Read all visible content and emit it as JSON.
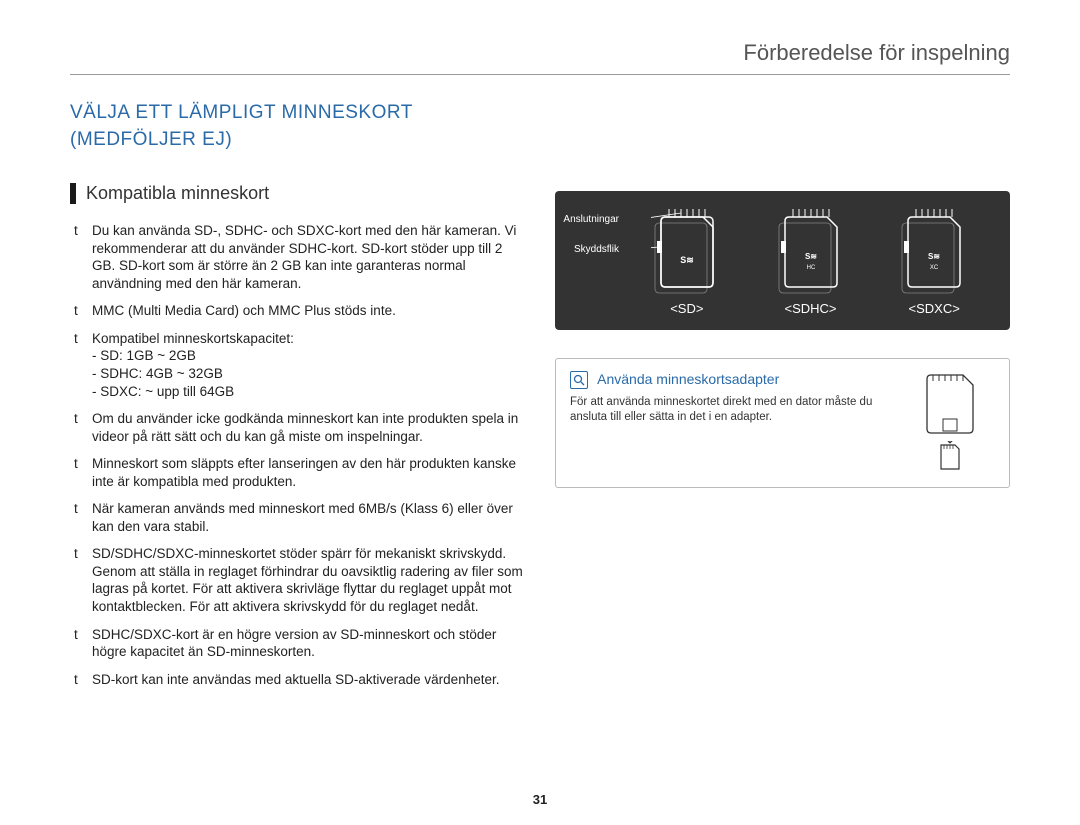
{
  "header": "Förberedelse för inspelning",
  "title_line1": "VÄLJA ETT LÄMPLIGT MINNESKORT",
  "title_line2": "(MEDFÖLJER EJ)",
  "subheading": "Kompatibla minneskort",
  "bullet_marker": "t",
  "bullets": {
    "b0": "Du kan använda SD-, SDHC- och SDXC-kort med den här kameran. Vi rekommenderar att du använder SDHC-kort. SD-kort stöder upp till 2 GB. SD-kort som är större än 2 GB kan inte garanteras normal användning med den här kameran.",
    "b1": "MMC (Multi Media Card) och MMC Plus stöds inte.",
    "b2": "Kompatibel minneskortskapacitet:",
    "b2_sub1": "- SD: 1GB ~ 2GB",
    "b2_sub2": "- SDHC: 4GB ~ 32GB",
    "b2_sub3": "- SDXC: ~ upp till 64GB",
    "b3": "Om du använder icke godkända minneskort kan inte produkten spela in videor på rätt sätt och du kan gå miste om inspelningar.",
    "b4": "Minneskort som släppts efter lanseringen av den här produkten kanske inte är kompatibla med produkten.",
    "b5": "När kameran används med minneskort med 6MB/s (Klass 6) eller över kan den vara stabil.",
    "b6": "SD/SDHC/SDXC-minneskortet stöder spärr för mekaniskt skrivskydd. Genom att ställa in reglaget förhindrar du oavsiktlig radering av filer som lagras på kortet. För att aktivera skrivläge flyttar du reglaget uppåt mot kontaktblecken. För att aktivera skrivskydd för du reglaget nedåt.",
    "b7": "SDHC/SDXC-kort är en högre version av SD-minneskort och stöder högre kapacitet än SD-minneskorten.",
    "b8": "SD-kort kan inte användas med aktuella SD-aktiverade värdenheter."
  },
  "diagram": {
    "callout_connectors": "Anslutningar",
    "callout_tab": "Skyddsflik",
    "labels": {
      "sd": "<SD>",
      "sdhc": "<SDHC>",
      "sdxc": "<SDXC>"
    }
  },
  "info": {
    "icon_glyph": "⦿",
    "title": "Använda minneskortsadapter",
    "text": "För att använda minneskortet direkt med en dator måste du ansluta till eller sätta in det i en adapter."
  },
  "page_number": "31"
}
